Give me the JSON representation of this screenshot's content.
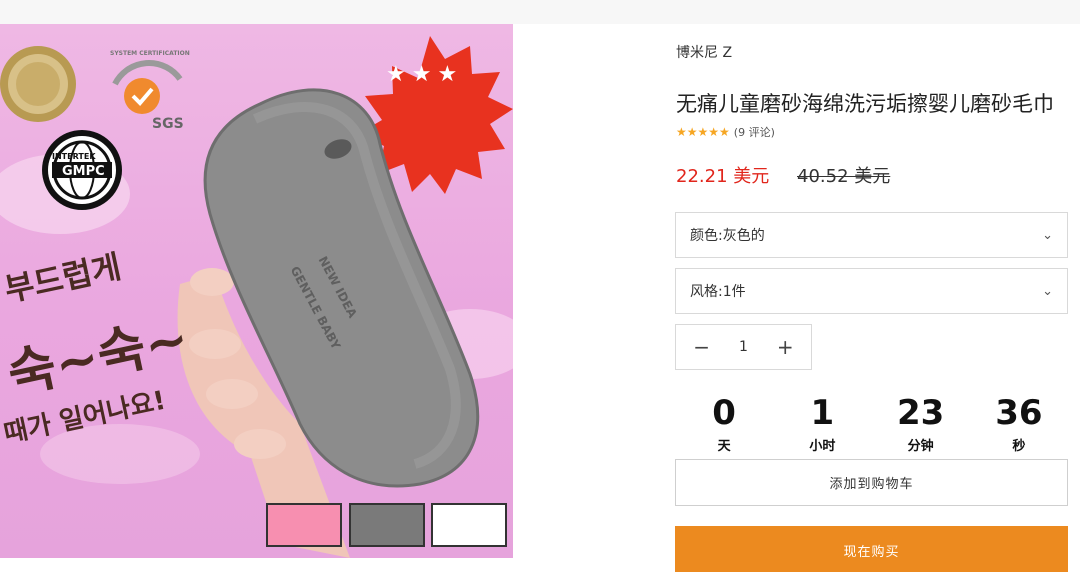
{
  "product": {
    "brand": "博米尼 Z",
    "title": "无痛儿童磨砂海绵洗污垢擦婴儿磨砂毛巾",
    "rating_stars": "★★★★★",
    "review_count": "(9 评论)",
    "price": "22.21 美元",
    "old_price": "40.52 美元"
  },
  "options": {
    "color_label": "颜色:",
    "color_value": "灰色的",
    "style_label": "风格:",
    "style_value": "1件"
  },
  "quantity": {
    "value": "1",
    "minus": "−",
    "plus": "+"
  },
  "countdown": [
    {
      "value": "0",
      "unit": "天"
    },
    {
      "value": "1",
      "unit": "小时"
    },
    {
      "value": "23",
      "unit": "分钟"
    },
    {
      "value": "36",
      "unit": "秒"
    }
  ],
  "actions": {
    "add_to_cart": "添加到购物车",
    "buy_now": "现在购买"
  },
  "hero": {
    "badge_stars": "★★★",
    "gmpc_top": "INTERTEK",
    "gmpc": "GMPC",
    "sgs_top": "SYSTEM CERTIFICATION",
    "sgs": "SGS",
    "korean_line1": "부드럽게",
    "korean_line2": "숙~숙~",
    "korean_line3": "때가 일어나요!",
    "sponge_text1": "NEW IDEA",
    "sponge_text2": "GENTLE BABY"
  },
  "swatches": [
    {
      "color": "#f78fb0"
    },
    {
      "color": "#7a7a7a"
    },
    {
      "color": "#ffffff"
    }
  ],
  "colors": {
    "price_red": "#e1261c",
    "buy_orange": "#ec8a1f",
    "star_gold": "#f6a623",
    "hero_pink": "#eaa7df"
  }
}
